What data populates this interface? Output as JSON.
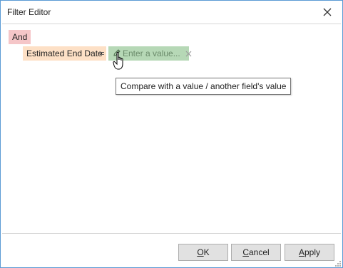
{
  "window": {
    "title": "Filter Editor"
  },
  "filter": {
    "group_operator": "And",
    "condition": {
      "field": "Estimated End Date",
      "operator": "=",
      "value_placeholder": "Enter a value..."
    }
  },
  "tooltip": {
    "text": "Compare with a value / another field's value"
  },
  "buttons": {
    "ok": {
      "mnemonic": "O",
      "rest": "K"
    },
    "cancel": {
      "mnemonic": "C",
      "rest": "ancel"
    },
    "apply": {
      "mnemonic": "A",
      "rest": "pply"
    }
  },
  "icons": {
    "close": "close-icon",
    "pencil": "pencil-icon",
    "remove": "remove-condition-icon",
    "cursor": "hand-pointer-cursor"
  },
  "colors": {
    "group_token": "#f5c6c8",
    "field_token": "#fde0c6",
    "value_token": "#b6d8b6",
    "window_border": "#5b9bd5"
  }
}
